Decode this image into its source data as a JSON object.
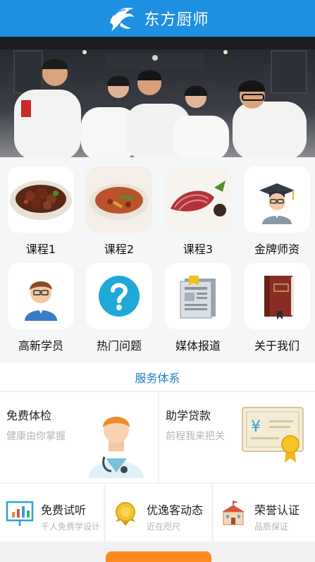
{
  "header": {
    "brand": "东方厨师",
    "logo_icon": "dolphin-logo-icon"
  },
  "colors": {
    "header_bg": "#1e8fe1",
    "service_title": "#1e7fc8",
    "accent_orange": "#ff8a1f"
  },
  "grid": [
    {
      "label": "课程1",
      "icon": "dish-braised-meat-icon"
    },
    {
      "label": "课程2",
      "icon": "dish-stir-fry-icon"
    },
    {
      "label": "课程3",
      "icon": "dish-sliced-meat-icon"
    },
    {
      "label": "金牌师资",
      "icon": "graduate-teacher-icon"
    },
    {
      "label": "高新学员",
      "icon": "student-avatar-icon"
    },
    {
      "label": "热门问题",
      "icon": "question-mark-icon"
    },
    {
      "label": "媒体报道",
      "icon": "newspaper-icon"
    },
    {
      "label": "关于我们",
      "icon": "book-icon"
    }
  ],
  "service": {
    "title": "服务体系",
    "panels": [
      {
        "title": "免费体检",
        "subtitle": "健康由你掌握",
        "icon": "doctor-icon"
      },
      {
        "title": "助学贷款",
        "subtitle": "前程我来把关",
        "icon": "certificate-icon"
      }
    ],
    "minis": [
      {
        "title": "免费试听",
        "subtitle": "千人免费学设计",
        "icon": "presentation-chart-icon"
      },
      {
        "title": "优逸客动态",
        "subtitle": "近在咫尺",
        "icon": "medal-icon"
      },
      {
        "title": "荣誉认证",
        "subtitle": "品质保证",
        "icon": "school-building-icon"
      }
    ]
  }
}
